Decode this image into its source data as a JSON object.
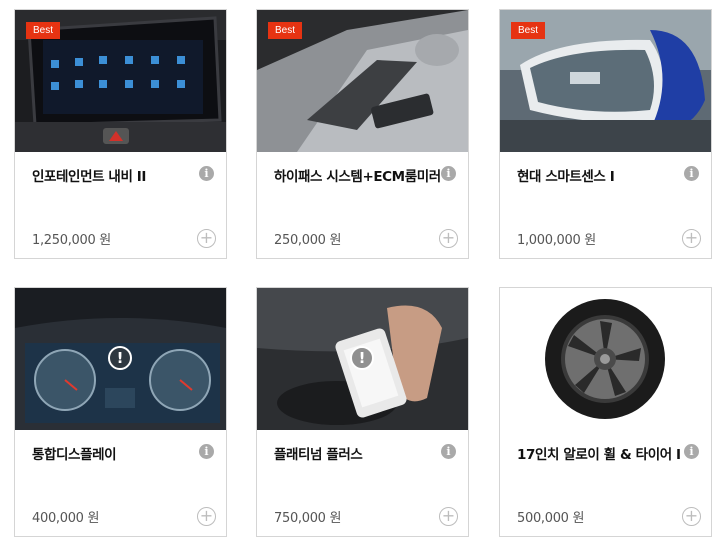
{
  "cards": [
    {
      "badge": "Best",
      "name": "인포테인먼트 내비 II",
      "price": "1,250,000 원",
      "info_icon": "info-icon",
      "add_icon": "plus-circle-icon"
    },
    {
      "badge": "Best",
      "name": "하이패스 시스템+ECM룸미러",
      "price": "250,000 원",
      "info_icon": "info-icon",
      "add_icon": "plus-circle-icon"
    },
    {
      "badge": "Best",
      "name": "현대 스마트센스 I",
      "price": "1,000,000 원",
      "info_icon": "info-icon",
      "add_icon": "plus-circle-icon"
    },
    {
      "alert": "!",
      "name": "통합디스플레이",
      "price": "400,000 원",
      "info_icon": "info-icon",
      "add_icon": "plus-circle-icon"
    },
    {
      "alert": "!",
      "name": "플래티넘 플러스",
      "price": "750,000 원",
      "info_icon": "info-icon",
      "add_icon": "plus-circle-icon"
    },
    {
      "name": "17인치 알로이 휠 & 타이어 I",
      "price": "500,000 원",
      "info_icon": "info-icon",
      "add_icon": "plus-circle-icon"
    }
  ],
  "colors": {
    "badge": "#e63312",
    "border": "#d5d5d5",
    "icon_gray": "#a9a9a9"
  }
}
